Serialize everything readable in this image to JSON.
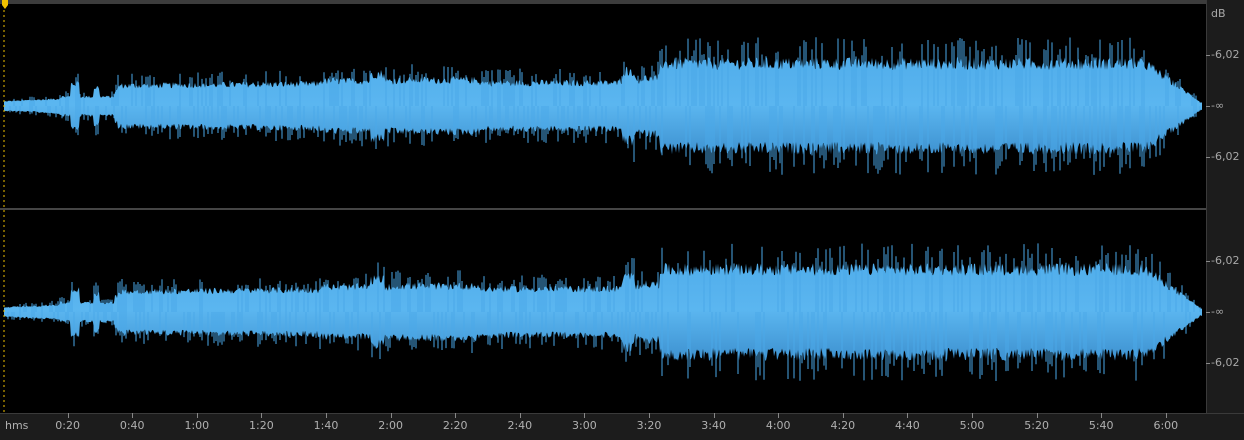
{
  "editor": {
    "waveform_color": "#4aa8e8",
    "waveform_color_dark": "#2f7fc0",
    "background_color": "#000000",
    "playhead_color": "#f2c200"
  },
  "db_ruler": {
    "unit": "dB",
    "channel_1_labels": [
      "-6,02",
      "-∞",
      "-6,02"
    ],
    "channel_2_labels": [
      "-6,02",
      "-∞",
      "-6,02"
    ]
  },
  "time_ruler": {
    "units": "hms",
    "labels": [
      "0:20",
      "0:40",
      "1:00",
      "1:20",
      "1:40",
      "2:00",
      "2:20",
      "2:40",
      "3:00",
      "3:20",
      "3:40",
      "4:00",
      "4:20",
      "4:40",
      "5:00",
      "5:20",
      "5:40",
      "6:00"
    ]
  }
}
